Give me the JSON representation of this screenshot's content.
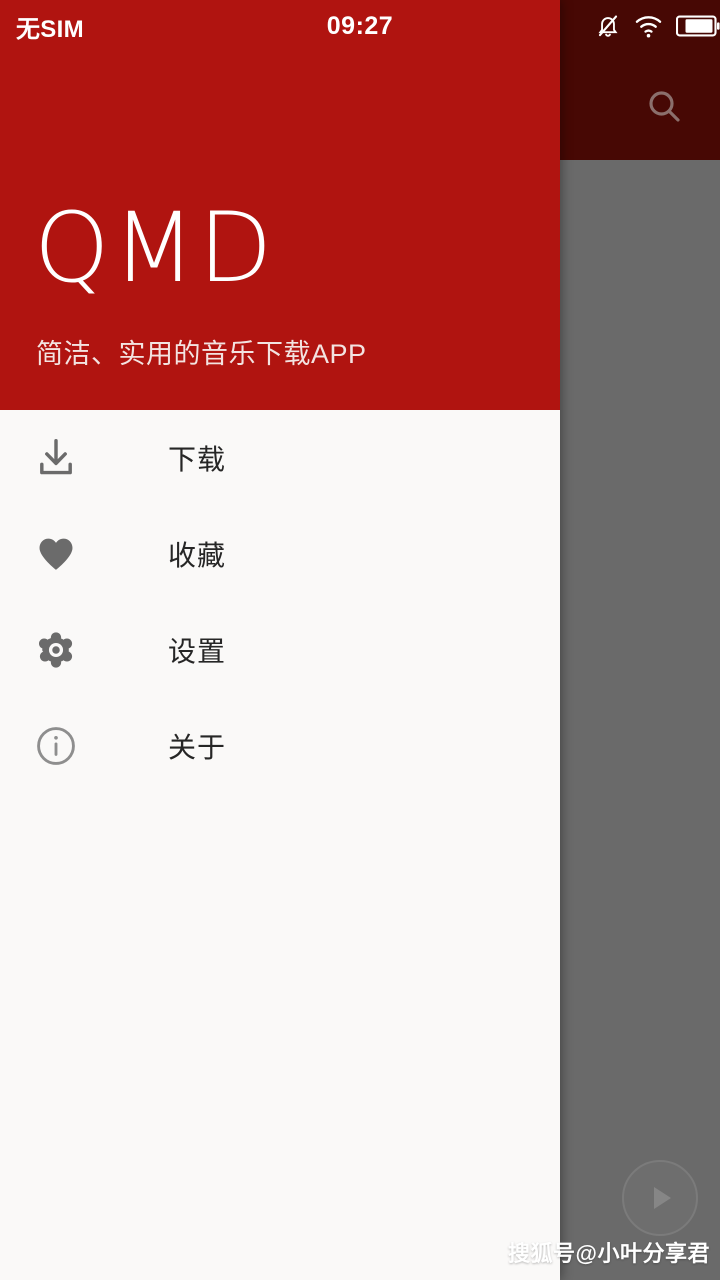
{
  "status_bar": {
    "carrier": "无SIM",
    "time": "09:27",
    "icons": [
      {
        "name": "silent-bell-icon",
        "label": "静音"
      },
      {
        "name": "wifi-icon",
        "label": "WiFi"
      },
      {
        "name": "battery-icon",
        "label": "电量"
      }
    ]
  },
  "drawer": {
    "header": {
      "title": "QMD",
      "tagline": "简洁、实用的音乐下载APP",
      "background_color": "#B01410",
      "title_color": "#FFFFFF"
    },
    "background_color": "#FAF9F8",
    "menu": [
      {
        "icon": "download-icon",
        "label": "下载"
      },
      {
        "icon": "heart-icon",
        "label": "收藏"
      },
      {
        "icon": "gear-icon",
        "label": "设置"
      },
      {
        "icon": "info-circle-icon",
        "label": "关于"
      }
    ]
  },
  "background_app": {
    "appbar_color": "#470804",
    "scrim_color": "#666666",
    "search_icon": "search-icon",
    "fab_icon": "play-icon"
  },
  "watermark": {
    "text": "搜狐号@小叶分享君"
  }
}
